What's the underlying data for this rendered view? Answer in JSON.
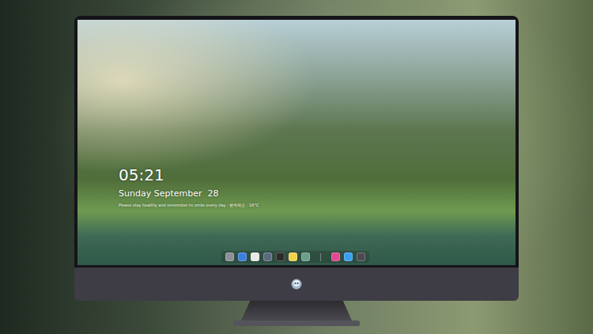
{
  "screen": {
    "clock": {
      "time": "05:21",
      "date": "Sunday September  28",
      "info": "Please stay healthy and remember to smile every day · 행복해요 · 16°C"
    }
  },
  "dock": {
    "items": [
      {
        "kind": "app",
        "color": "#8a8f99"
      },
      {
        "kind": "app",
        "color": "#3d7fe0"
      },
      {
        "kind": "app",
        "color": "#e8e8e8"
      },
      {
        "kind": "app",
        "color": "#5a6b7d"
      },
      {
        "kind": "app",
        "color": "#2b2b2b"
      },
      {
        "kind": "app",
        "color": "#f2d24b"
      },
      {
        "kind": "app",
        "color": "#6aa08a"
      },
      {
        "kind": "divider"
      },
      {
        "kind": "app",
        "color": "#e0488f"
      },
      {
        "kind": "app",
        "color": "#3a9ef0"
      },
      {
        "kind": "app",
        "color": "#4a4a52"
      }
    ]
  }
}
